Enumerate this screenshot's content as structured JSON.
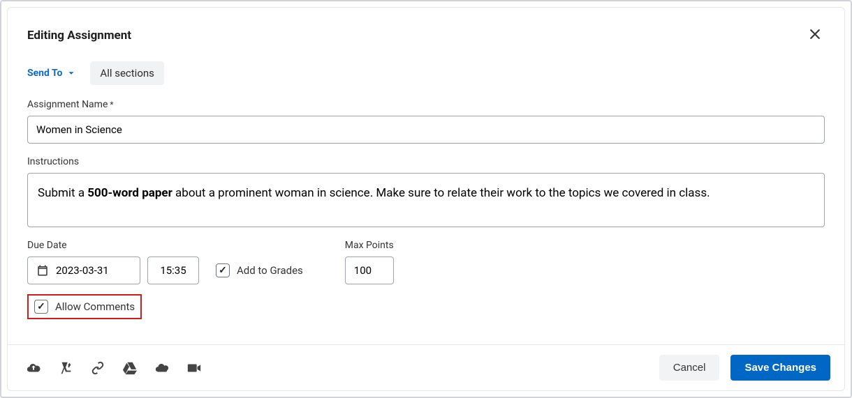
{
  "header": {
    "title": "Editing Assignment"
  },
  "sendto": {
    "label": "Send To",
    "chip": "All sections"
  },
  "name": {
    "label": "Assignment Name",
    "value": "Women in Science"
  },
  "instructions": {
    "label": "Instructions",
    "prefix": "Submit a ",
    "bold": "500-word paper",
    "suffix": " about a prominent woman in science. Make sure to relate their work to the topics we covered in class."
  },
  "duedate": {
    "label": "Due Date",
    "date": "2023-03-31",
    "time": "15:35"
  },
  "addgrades": {
    "label": "Add to Grades"
  },
  "points": {
    "label": "Max Points",
    "value": "100"
  },
  "allowcomments": {
    "label": "Allow Comments"
  },
  "footer": {
    "cancel": "Cancel",
    "save": "Save Changes"
  }
}
